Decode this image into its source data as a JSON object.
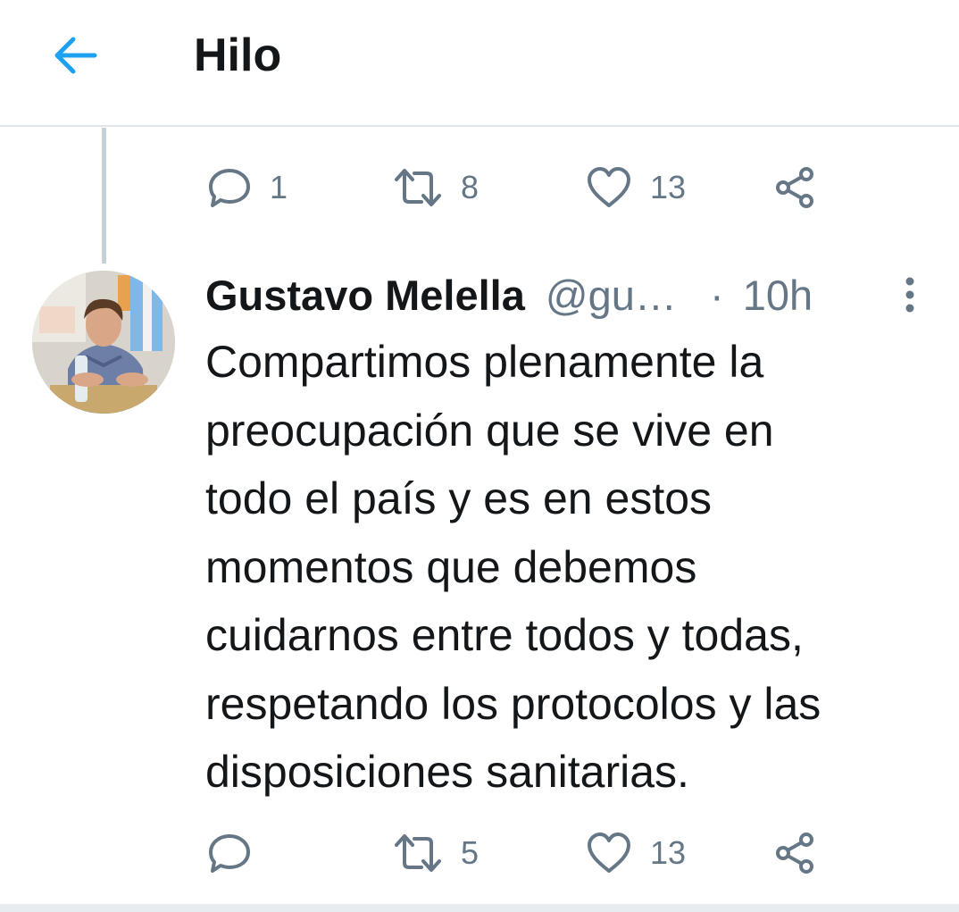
{
  "header": {
    "title": "Hilo",
    "back_icon": "arrow-left-icon"
  },
  "colors": {
    "accent": "#1da1f2",
    "text": "#14171a",
    "muted": "#657786",
    "divider": "#e1e8ed"
  },
  "parent_actions": {
    "replies": "1",
    "retweets": "8",
    "likes": "13"
  },
  "tweet": {
    "author_name": "Gustavo Melella",
    "handle": "@gu…",
    "separator": "·",
    "time": "10h",
    "text_lines": [
      "Compartimos plenamente la",
      "preocupación que se vive en",
      "todo el país y es en estos",
      "momentos que debemos",
      "cuidarnos entre todos y todas,",
      "respetando los protocolos y las",
      "disposiciones sanitarias."
    ],
    "actions": {
      "replies": "",
      "retweets": "5",
      "likes": "13"
    }
  }
}
